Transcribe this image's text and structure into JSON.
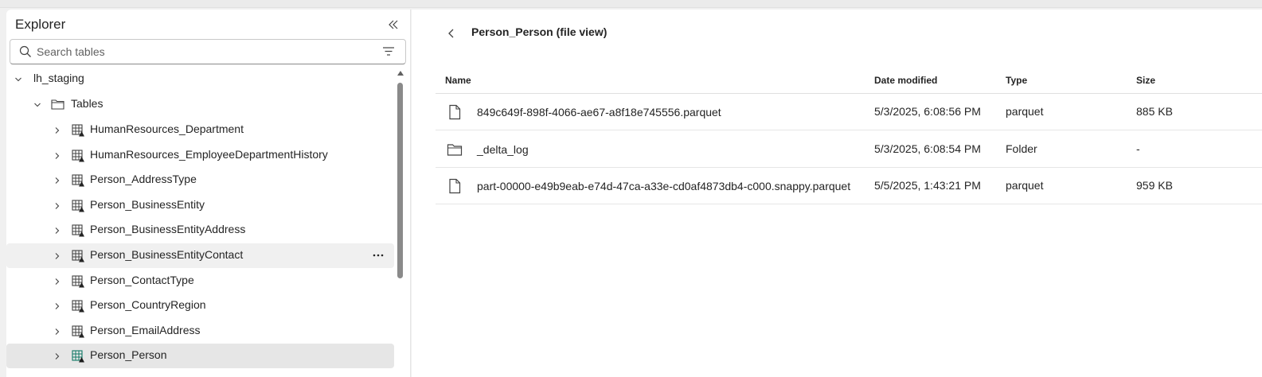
{
  "explorer": {
    "title": "Explorer",
    "search_placeholder": "Search tables",
    "tree": {
      "root_label": "lh_staging",
      "tables_folder_label": "Tables",
      "tables": [
        {
          "label": "HumanResources_Department"
        },
        {
          "label": "HumanResources_EmployeeDepartmentHistory"
        },
        {
          "label": "Person_AddressType"
        },
        {
          "label": "Person_BusinessEntity"
        },
        {
          "label": "Person_BusinessEntityAddress"
        },
        {
          "label": "Person_BusinessEntityContact"
        },
        {
          "label": "Person_ContactType"
        },
        {
          "label": "Person_CountryRegion"
        },
        {
          "label": "Person_EmailAddress"
        },
        {
          "label": "Person_Person"
        }
      ],
      "hovered_table": "Person_BusinessEntityContact",
      "selected_table": "Person_Person"
    }
  },
  "main": {
    "title": "Person_Person (file view)",
    "columns": {
      "name": "Name",
      "date_modified": "Date modified",
      "type": "Type",
      "size": "Size"
    },
    "rows": [
      {
        "icon": "file-icon",
        "name": "849c649f-898f-4066-ae67-a8f18e745556.parquet",
        "date_modified": "5/3/2025, 6:08:56 PM",
        "type": "parquet",
        "size": "885 KB"
      },
      {
        "icon": "folder-icon",
        "name": "_delta_log",
        "date_modified": "5/3/2025, 6:08:54 PM",
        "type": "Folder",
        "size": "-"
      },
      {
        "icon": "file-icon",
        "name": "part-00000-e49b9eab-e74d-47ca-a33e-cd0af4873db4-c000.snappy.parquet",
        "date_modified": "5/5/2025, 1:43:21 PM",
        "type": "parquet",
        "size": "959 KB"
      }
    ]
  },
  "colors": {
    "selected_table_icon": "#117865",
    "selected_row_bg": "#e6e6e6",
    "hover_row_bg": "#f0f0f0"
  }
}
